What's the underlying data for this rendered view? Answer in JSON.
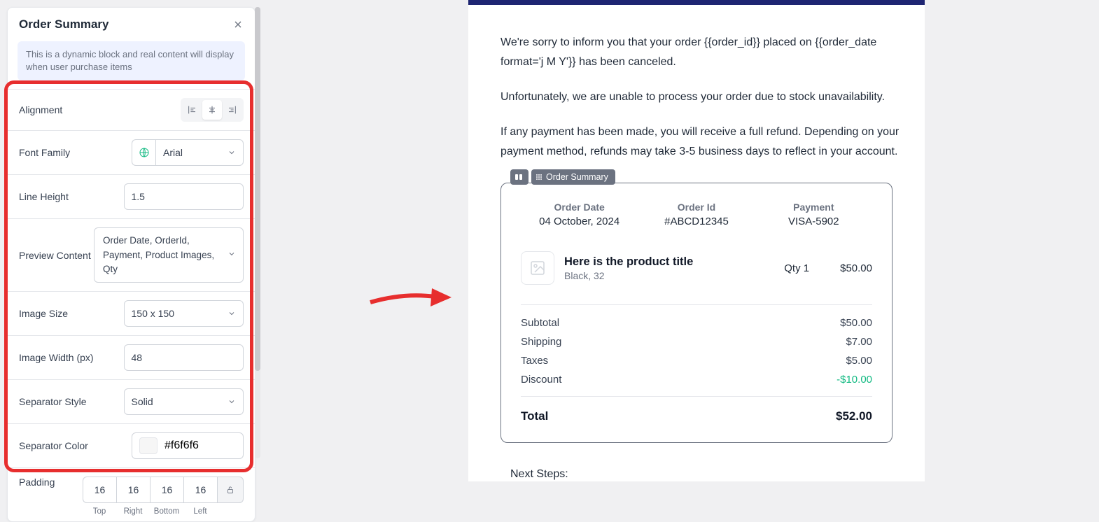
{
  "panel": {
    "title": "Order Summary",
    "info": "This is a dynamic block and real content will display when user purchase items",
    "fields": {
      "alignment": {
        "label": "Alignment"
      },
      "fontFamily": {
        "label": "Font Family",
        "value": "Arial"
      },
      "lineHeight": {
        "label": "Line Height",
        "value": "1.5"
      },
      "previewContent": {
        "label": "Preview Content",
        "value": "Order Date, OrderId, Payment, Product Images, Qty"
      },
      "imageSize": {
        "label": "Image Size",
        "value": "150 x 150"
      },
      "imageWidth": {
        "label": "Image Width (px)",
        "value": "48"
      },
      "separatorStyle": {
        "label": "Separator Style",
        "value": "Solid"
      },
      "separatorColor": {
        "label": "Separator Color",
        "value": "#f6f6f6"
      },
      "padding": {
        "label": "Padding",
        "top": "16",
        "right": "16",
        "bottom": "16",
        "left": "16",
        "labels": {
          "top": "Top",
          "right": "Right",
          "bottom": "Bottom",
          "left": "Left"
        }
      }
    }
  },
  "preview": {
    "blockLabel": "Order Summary",
    "paragraphs": [
      "We're sorry to inform you that your order {{order_id}} placed on {{order_date format='j M Y'}} has been canceled.",
      "Unfortunately, we are unable to process your order due to stock unavailability.",
      "If any payment has been made, you will receive a full refund. Depending on your payment method, refunds may take 3-5 business days to reflect in your account."
    ],
    "order": {
      "meta": [
        {
          "label": "Order Date",
          "value": "04 October, 2024"
        },
        {
          "label": "Order Id",
          "value": "#ABCD12345"
        },
        {
          "label": "Payment",
          "value": "VISA-5902"
        }
      ],
      "product": {
        "title": "Here is the product title",
        "variant": "Black, 32",
        "qty": "Qty 1",
        "price": "$50.00"
      },
      "totals": [
        {
          "label": "Subtotal",
          "value": "$50.00",
          "class": ""
        },
        {
          "label": "Shipping",
          "value": "$7.00",
          "class": ""
        },
        {
          "label": "Taxes",
          "value": "$5.00",
          "class": ""
        },
        {
          "label": "Discount",
          "value": "-$10.00",
          "class": "discount"
        }
      ],
      "grandTotal": {
        "label": "Total",
        "value": "$52.00"
      }
    },
    "nextSteps": "Next Steps:"
  },
  "colors": {
    "highlight": "#e72e2e",
    "accent": "#10b981"
  }
}
